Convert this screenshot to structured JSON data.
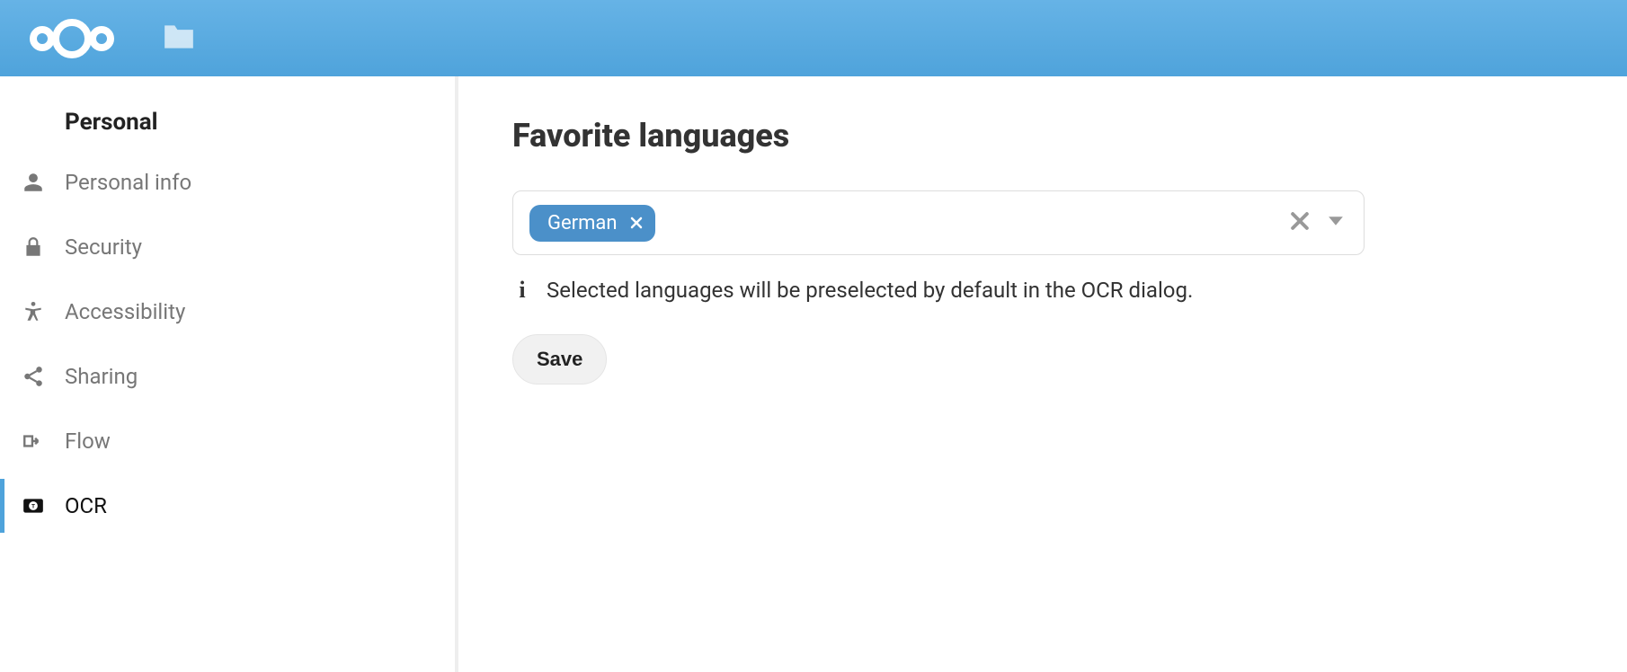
{
  "sidebar": {
    "heading": "Personal",
    "items": [
      {
        "label": "Personal info",
        "icon": "person"
      },
      {
        "label": "Security",
        "icon": "lock"
      },
      {
        "label": "Accessibility",
        "icon": "accessibility"
      },
      {
        "label": "Sharing",
        "icon": "share"
      },
      {
        "label": "Flow",
        "icon": "flow"
      },
      {
        "label": "OCR",
        "icon": "ocr"
      }
    ]
  },
  "main": {
    "title": "Favorite languages",
    "hint": "Selected languages will be preselected by default in the OCR dialog.",
    "selected_languages": [
      {
        "name": "German"
      }
    ],
    "save_label": "Save"
  }
}
